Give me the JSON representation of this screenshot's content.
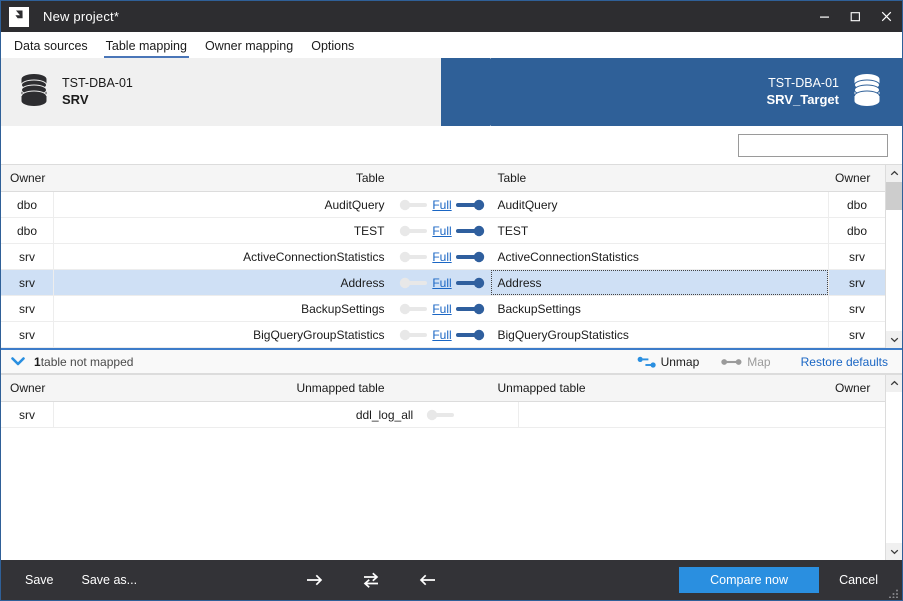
{
  "window": {
    "title": "New project*",
    "logo_icon": "app-logo-icon",
    "minimize_icon": "minimize-icon",
    "maximize_icon": "maximize-icon",
    "close_icon": "close-icon"
  },
  "tabs": [
    {
      "label": "Data sources",
      "active": false
    },
    {
      "label": "Table mapping",
      "active": true
    },
    {
      "label": "Owner mapping",
      "active": false
    },
    {
      "label": "Options",
      "active": false
    }
  ],
  "banner": {
    "source": {
      "server": "TST-DBA-01",
      "database": "SRV",
      "icon": "database-icon"
    },
    "target": {
      "server": "TST-DBA-01",
      "database": "SRV_Target",
      "icon": "database-icon"
    },
    "accent_color": "#2f6098"
  },
  "search": {
    "value": "",
    "placeholder": "",
    "icon": "search-icon"
  },
  "mapped_grid": {
    "headers": {
      "owner_left": "Owner",
      "table_left": "Table",
      "table_right": "Table",
      "owner_right": "Owner"
    },
    "rows": [
      {
        "owner_left": "dbo",
        "table_left": "AuditQuery",
        "mapping": "Full",
        "table_right": "AuditQuery",
        "owner_right": "dbo",
        "selected": false
      },
      {
        "owner_left": "dbo",
        "table_left": "TEST",
        "mapping": "Full",
        "table_right": "TEST",
        "owner_right": "dbo",
        "selected": false
      },
      {
        "owner_left": "srv",
        "table_left": "ActiveConnectionStatistics",
        "mapping": "Full",
        "table_right": "ActiveConnectionStatistics",
        "owner_right": "srv",
        "selected": false
      },
      {
        "owner_left": "srv",
        "table_left": "Address",
        "mapping": "Full",
        "table_right": "Address",
        "owner_right": "srv",
        "selected": true
      },
      {
        "owner_left": "srv",
        "table_left": "BackupSettings",
        "mapping": "Full",
        "table_right": "BackupSettings",
        "owner_right": "srv",
        "selected": false
      },
      {
        "owner_left": "srv",
        "table_left": "BigQueryGroupStatistics",
        "mapping": "Full",
        "table_right": "BigQueryGroupStatistics",
        "owner_right": "srv",
        "selected": false
      }
    ]
  },
  "midbar": {
    "expander_icon": "chevron-down-icon",
    "count": "1",
    "status_text": " table not mapped",
    "unmap": {
      "label": "Unmap",
      "icon": "unmap-icon",
      "enabled": true
    },
    "map": {
      "label": "Map",
      "icon": "map-icon",
      "enabled": false
    },
    "restore_defaults": "Restore defaults"
  },
  "unmapped_grid": {
    "headers": {
      "owner_left": "Owner",
      "table_left": "Unmapped table",
      "table_right": "Unmapped table",
      "owner_right": "Owner"
    },
    "rows": [
      {
        "owner_left": "srv",
        "table_left": "ddl_log_all",
        "table_right": "",
        "owner_right": ""
      }
    ]
  },
  "bottom_bar": {
    "save": "Save",
    "save_as": "Save as...",
    "nav_right_icon": "arrow-right-icon",
    "nav_swap_icon": "swap-arrows-icon",
    "nav_left_icon": "arrow-left-icon",
    "compare_now": "Compare now",
    "cancel": "Cancel",
    "primary_color": "#2a8fe0",
    "resize_grip_icon": "resize-grip-icon"
  }
}
